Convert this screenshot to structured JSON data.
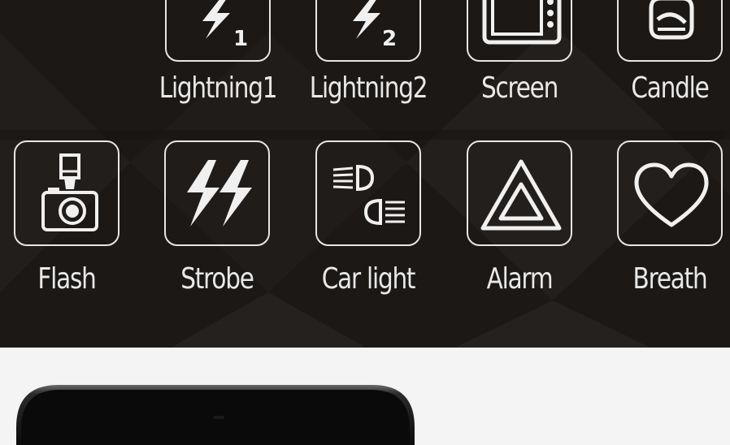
{
  "modes_row1": [
    {
      "label": "Lightning1",
      "icon": "lightning-1-icon"
    },
    {
      "label": "Lightning2",
      "icon": "lightning-2-icon"
    },
    {
      "label": "Screen",
      "icon": "tv-screen-icon"
    },
    {
      "label": "Candle",
      "icon": "candle-icon"
    }
  ],
  "modes_row2": [
    {
      "label": "Flash",
      "icon": "camera-flash-icon"
    },
    {
      "label": "Strobe",
      "icon": "strobe-icon"
    },
    {
      "label": "Car light",
      "icon": "car-headlight-icon"
    },
    {
      "label": "Alarm",
      "icon": "alarm-triangle-icon"
    },
    {
      "label": "Breath",
      "icon": "heart-icon"
    }
  ],
  "lightning_subscripts": [
    "1",
    "2"
  ],
  "colors": {
    "panel_bg": "#1b1816",
    "icon_stroke": "#e6e6e6",
    "label_text": "#e8e8e8",
    "page_bg": "#f4f4f5"
  }
}
